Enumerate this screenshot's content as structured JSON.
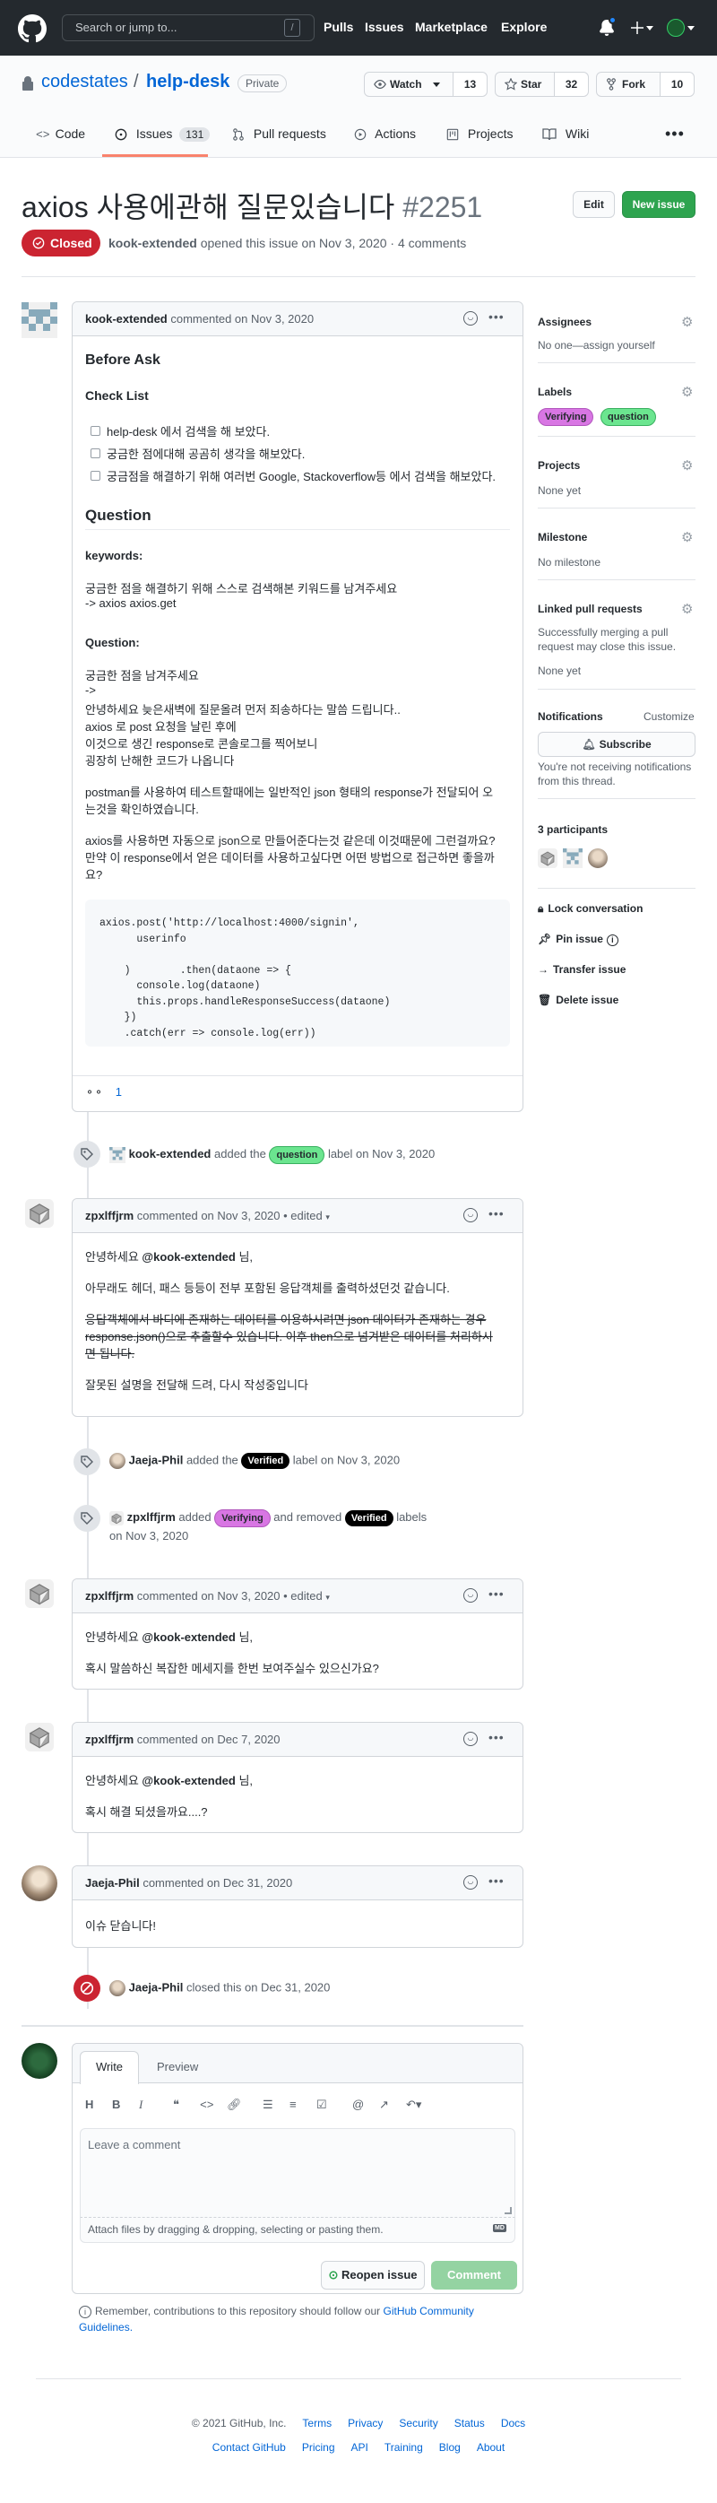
{
  "header": {
    "search_placeholder": "Search or jump to...",
    "slash": "/",
    "nav": [
      "Pulls",
      "Issues",
      "Marketplace",
      "Explore"
    ]
  },
  "repo": {
    "owner": "codestates",
    "sep": "/",
    "name": "help-desk",
    "visibility": "Private",
    "watch_label": "Watch",
    "watch_count": "13",
    "star_label": "Star",
    "star_count": "32",
    "fork_label": "Fork",
    "fork_count": "10"
  },
  "tabs": {
    "code": "Code",
    "issues": "Issues",
    "issues_count": "131",
    "pulls": "Pull requests",
    "actions": "Actions",
    "projects": "Projects",
    "wiki": "Wiki"
  },
  "issue": {
    "title": "axios 사용에관해 질문있습니다",
    "number": "#2251",
    "state": "Closed",
    "author": "kook-extended",
    "opened_text": "opened this issue on Nov 3, 2020 · 4 comments",
    "edit_button": "Edit",
    "new_issue_button": "New issue"
  },
  "first_comment": {
    "author": "kook-extended",
    "meta": "commented on Nov 3, 2020",
    "h_before": "Before Ask",
    "h_checklist": "Check List",
    "checks": [
      "help-desk 에서 검색을 해 보았다.",
      "궁금한 점에대해 공곰히 생각을 해보았다.",
      "궁금점을 해결하기 위해 여러번 Google, Stackoverflow등 에서 검색을 해보았다."
    ],
    "h_question": "Question",
    "keywords_label": "keywords:",
    "kw1": "궁금한 점을 해결하기 위해 스스로 검색해본 키워드를 남겨주세요",
    "kw2": "-> axios axios.get",
    "question_label": "Question:",
    "q1": "궁금한 점을 남겨주세요",
    "q2": "->",
    "q3": "안녕하세요 늦은새벽에 질문올려 먼저 죄송하다는 말씀 드립니다..",
    "q4": "axios 로 post 요청을 날린 후에",
    "q5": "이것으로 생긴 response로 콘솔로그를 찍어보니",
    "q6": "굉장히 난해한 코드가 나옵니다",
    "p1a": "postman를 사용하여 테스트할때에는 일반적인 json 형태의 response가 전달되어 오",
    "p1b": "는것을 확인하였습니다.",
    "p2a": "axios를 사용하면 자동으로 json으로 만들어준다는것 같은데 이것때문에 그런걸까요?",
    "p2b": "만약 이 response에서 얻은 데이터를 사용하고싶다면 어떤 방법으로 접근하면 좋을까",
    "p2c": "요?",
    "code": [
      "axios.post('http://localhost:4000/signin',",
      "      userinfo",
      "",
      "    )        .then(dataone => {",
      "      console.log(dataone)",
      "      this.props.handleResponseSuccess(dataone)",
      "    })",
      "    .catch(err => console.log(err))"
    ],
    "reaction_count": "1"
  },
  "sidebar": {
    "assignees": "Assignees",
    "assignees_val": "No one—assign yourself",
    "labels": "Labels",
    "label1": "Verifying",
    "label2": "question",
    "projects": "Projects",
    "projects_val": "None yet",
    "milestone": "Milestone",
    "milestone_val": "No milestone",
    "linked": "Linked pull requests",
    "linked_desc1": "Successfully merging a pull",
    "linked_desc2": "request may close this issue.",
    "linked_val": "None yet",
    "notifications": "Notifications",
    "customize": "Customize",
    "subscribe": "Subscribe",
    "notif_desc1": "You're not receiving notifications",
    "notif_desc2": "from this thread.",
    "participants": "3 participants",
    "lock": "Lock conversation",
    "pin": "Pin issue",
    "transfer": "Transfer issue",
    "delete": "Delete issue"
  },
  "events": {
    "e1_actor": "kook-extended",
    "e1_added": "added the",
    "e1_label": "question",
    "e1_after": "label on Nov 3, 2020",
    "e2_actor": "Jaeja-Phil",
    "e2_added": "added the",
    "e2_label": "Verified",
    "e2_after": "label on Nov 3, 2020",
    "e3_actor": "zpxlffjrm",
    "e3_added": "added",
    "e3_label1": "Verifying",
    "e3_mid": "and removed",
    "e3_label2": "Verified",
    "e3_after": "labels",
    "e3_date": "on Nov 3, 2020",
    "e4_actor": "Jaeja-Phil",
    "e4_text": "closed this on Dec 31, 2020"
  },
  "comment2": {
    "author": "zpxlffjrm",
    "meta": "commented on Nov 3, 2020 • edited",
    "l1a": "안녕하세요 ",
    "mention": "@kook-extended",
    "l1b": " 님,",
    "l2": "아무래도 헤더, 패스 등등이 전부 포함된 응답객체를 출력하셨던것 같습니다.",
    "s1": "응답객체에서 바디에 존재하는 데이터를 이용하시려면 json 데이터가 존재하는 경우",
    "s2": "response.json()으로 추출할수 있습니다. 이후 then으로 넘겨받은 데이터를 처리하시",
    "s3": "면 됩니다.",
    "l4": "잘못된 설명을 전달해 드려, 다시 작성중입니다"
  },
  "comment3": {
    "author": "zpxlffjrm",
    "meta": "commented on Nov 3, 2020 • edited",
    "l1a": "안녕하세요 ",
    "mention": "@kook-extended",
    "l1b": " 님,",
    "l2": "혹시 말씀하신 복잡한 메세지를 한번 보여주실수 있으신가요?"
  },
  "comment4": {
    "author": "zpxlffjrm",
    "meta": "commented on Dec 7, 2020",
    "l1a": "안녕하세요 ",
    "mention": "@kook-extended",
    "l1b": " 님,",
    "l2": "혹시 해결 되셨을까요....?"
  },
  "comment5": {
    "author": "Jaeja-Phil",
    "meta": "commented on Dec 31, 2020",
    "l1": "이슈 닫습니다!"
  },
  "editor": {
    "write": "Write",
    "preview": "Preview",
    "placeholder": "Leave a comment",
    "attach": "Attach files by dragging & dropping, selecting or pasting them.",
    "md": "MD",
    "reopen": "Reopen issue",
    "comment": "Comment",
    "remember": "Remember, contributions to this repository should follow our",
    "guidelines1": "GitHub Community",
    "guidelines2": "Guidelines."
  },
  "footer": {
    "copyright": "© 2021 GitHub, Inc.",
    "links1": [
      "Terms",
      "Privacy",
      "Security",
      "Status",
      "Docs"
    ],
    "links2": [
      "Contact GitHub",
      "Pricing",
      "API",
      "Training",
      "Blog",
      "About"
    ]
  },
  "colors": {
    "closed": "#cb2431",
    "green": "#2ea44f",
    "verifying_bg": "#d876e3",
    "question_bg": "#6be58f",
    "verified_bg": "#000000",
    "link": "#0366d6"
  }
}
